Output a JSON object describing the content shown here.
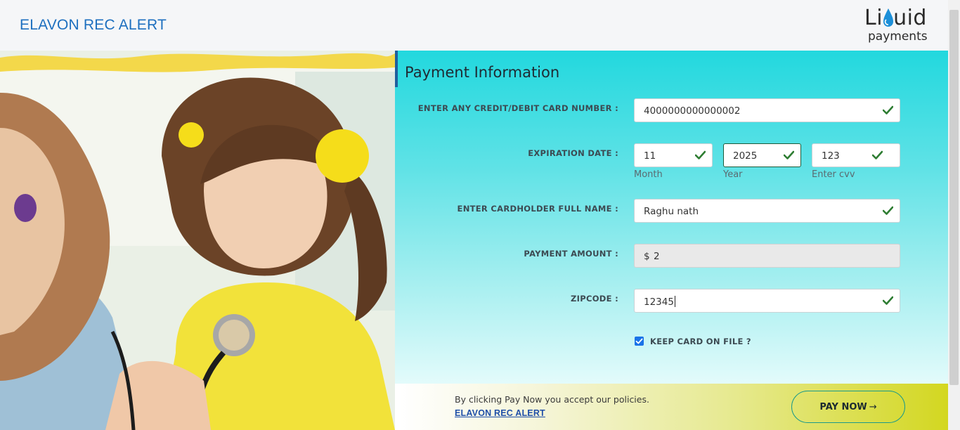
{
  "header": {
    "title": "ELAVON REC ALERT",
    "logo_word": "Liquid",
    "logo_sub": "payments"
  },
  "panel": {
    "title": "Payment Information"
  },
  "form": {
    "card_number": {
      "label": "ENTER ANY CREDIT/DEBIT CARD NUMBER :",
      "value": "4000000000000002"
    },
    "expiration": {
      "label": "EXPIRATION DATE :",
      "month": {
        "value": "11",
        "sublabel": "Month"
      },
      "year": {
        "value": "2025",
        "sublabel": "Year"
      },
      "cvv": {
        "value": "123",
        "sublabel": "Enter cvv"
      }
    },
    "cardholder": {
      "label": "ENTER CARDHOLDER FULL NAME :",
      "value": "Raghu nath"
    },
    "amount": {
      "label": "PAYMENT AMOUNT :",
      "currency": "$",
      "value": "2"
    },
    "zipcode": {
      "label": "ZIPCODE :",
      "value": "12345"
    },
    "keep_card": {
      "label": "KEEP CARD ON FILE ?",
      "checked": true
    }
  },
  "footer": {
    "policy_text": "By clicking Pay Now you accept our policies.",
    "policy_link": "ELAVON REC ALERT",
    "pay_button": "PAY NOW",
    "pay_arrow": "→"
  },
  "colors": {
    "brand_blue": "#1d6fbf",
    "valid_check": "#2e7d32",
    "panel_top": "#22d8de",
    "footer_accent": "#d2d61a"
  }
}
